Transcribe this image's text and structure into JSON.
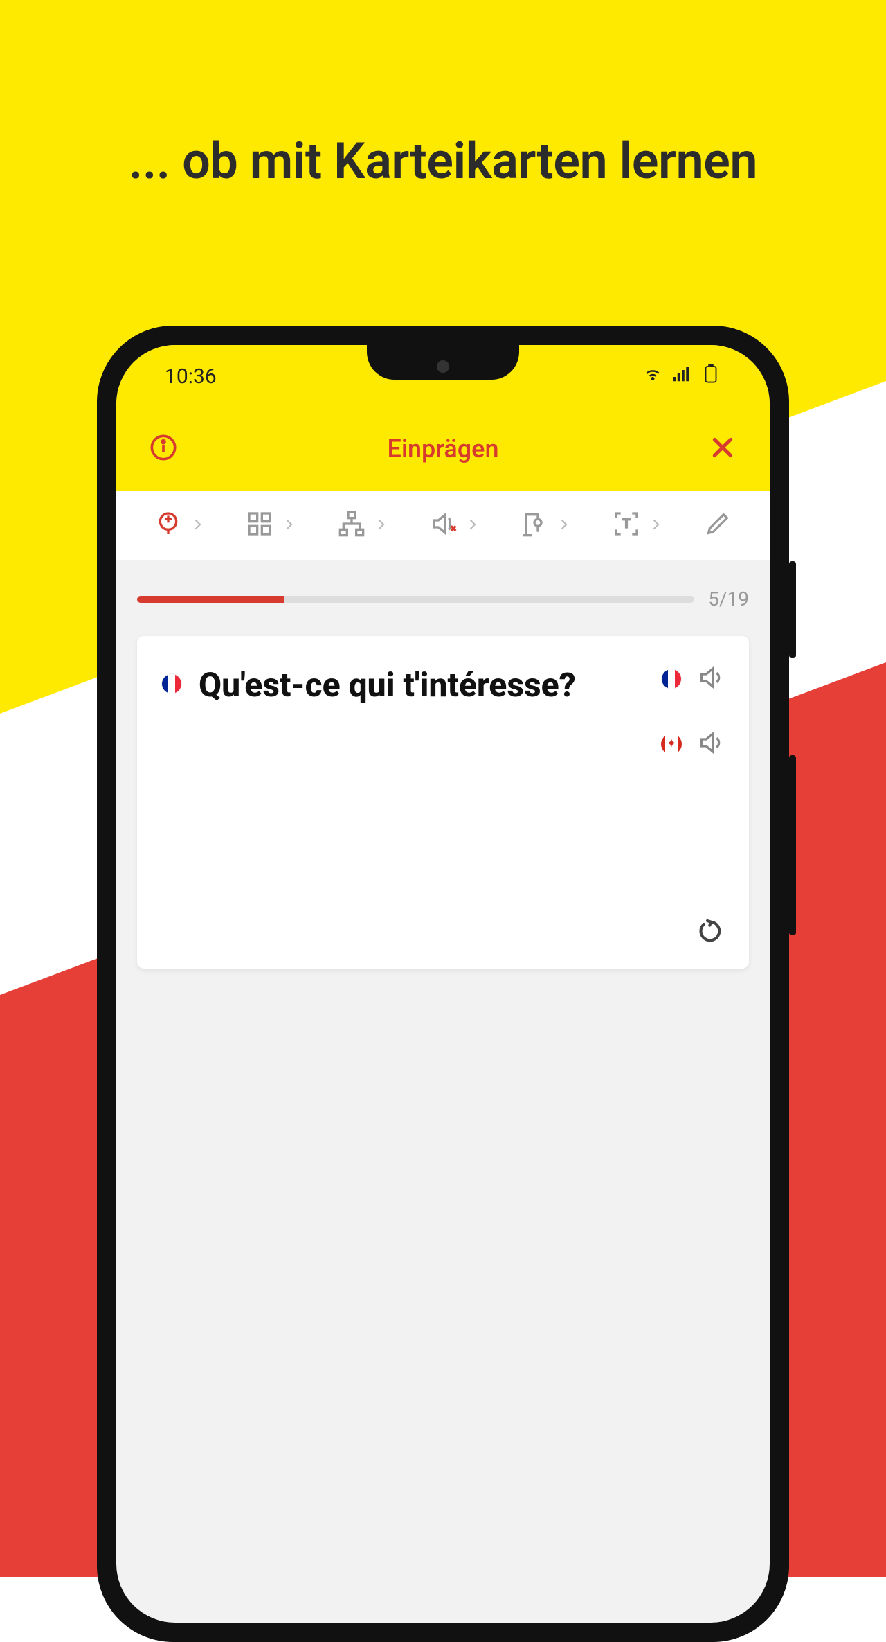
{
  "headline": "... ob mit Karteikarten lernen",
  "statusBar": {
    "time": "10:36"
  },
  "titleBar": {
    "title": "Einprägen"
  },
  "progress": {
    "label": "5/19",
    "percent": 26.3
  },
  "card": {
    "question": "Qu'est-ce qui t'intéresse?"
  },
  "colors": {
    "yellow": "#fee900",
    "red": "#d73a2e"
  }
}
